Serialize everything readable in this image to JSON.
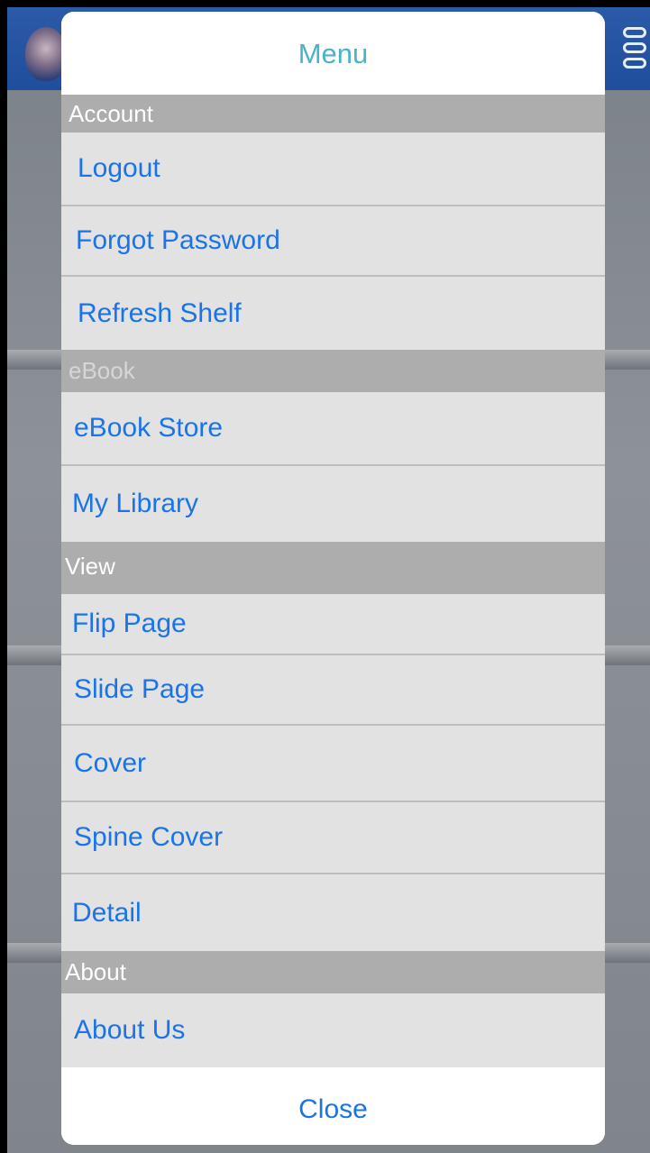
{
  "dialog": {
    "title": "Menu",
    "close_label": "Close"
  },
  "sections": {
    "account": {
      "header": "Account",
      "items": [
        "Logout",
        "Forgot Password",
        "Refresh Shelf"
      ]
    },
    "ebook": {
      "header": "eBook",
      "items": [
        "eBook Store",
        "My Library"
      ]
    },
    "view": {
      "header": "View",
      "items": [
        "Flip Page",
        "Slide Page",
        "Cover",
        "Spine Cover",
        "Detail"
      ]
    },
    "about": {
      "header": "About",
      "items": [
        "About Us"
      ]
    }
  },
  "colors": {
    "title": "#4ab3c8",
    "link": "#1a74e8",
    "section_header_bg": "#adadad",
    "item_bg": "#e2e2e2"
  },
  "icons": {
    "app_logo": "seal-logo-icon",
    "menu": "hamburger-menu-icon"
  }
}
